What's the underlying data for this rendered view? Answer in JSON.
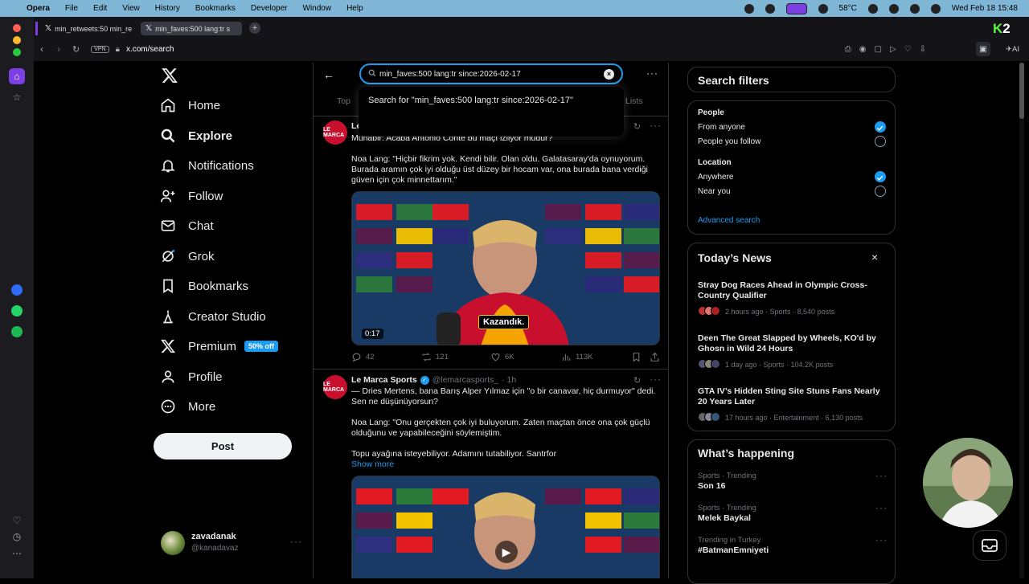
{
  "menubar": {
    "app": "Opera",
    "items": [
      "File",
      "Edit",
      "View",
      "History",
      "Bookmarks",
      "Developer",
      "Window",
      "Help"
    ],
    "temperature": "58°C",
    "datetime": "Wed Feb 18  15:48"
  },
  "browser": {
    "tabs": [
      {
        "title": "min_retweets:50 min_re"
      },
      {
        "title": "min_faves:500 lang:tr s"
      }
    ],
    "vpn_label": "VPN",
    "url": "x.com/search",
    "ai_label": "AI",
    "brand": "K2"
  },
  "nav": {
    "home": "Home",
    "explore": "Explore",
    "notifications": "Notifications",
    "follow": "Follow",
    "chat": "Chat",
    "grok": "Grok",
    "bookmarks": "Bookmarks",
    "creator_studio": "Creator Studio",
    "premium": "Premium",
    "premium_badge": "50% off",
    "profile": "Profile",
    "more": "More",
    "post": "Post"
  },
  "account": {
    "name": "zavadanak",
    "handle": "@kanadavaz"
  },
  "search": {
    "query": "min_faves:500 lang:tr since:2026-02-17",
    "suggestion": "Search for \"min_faves:500 lang:tr since:2026-02-17\"",
    "tab_top": "Top",
    "tab_lists": "Lists"
  },
  "tweets": [
    {
      "avatar_text": "LE MARCA",
      "name_partial": "Le",
      "lines": "Muhabir: Acaba Antonio Conte bu maçı izliyor mudur?\n\nNoa Lang: \"Hiçbir fikrim yok. Kendi bilir. Olan oldu. Galatasaray'da oynuyorum. Burada aramın çok iyi olduğu üst düzey bir hocam var, ona burada bana verdiği güven için çok minnettarım.\"",
      "video_duration": "0:17",
      "subtitle": "Kazandık.",
      "replies": "42",
      "reposts": "121",
      "likes": "6K",
      "views": "113K"
    },
    {
      "avatar_text": "LE MARCA",
      "name": "Le Marca Sports",
      "handle": "@lemarcasports_",
      "time": "· 1h",
      "lines": "— Dries Mertens, bana Barış Alper Yılmaz için \"o bir canavar, hiç durmuyor\" dedi. Sen ne düşünüyorsun?\n\nNoa Lang: \"Onu gerçekten çok iyi buluyorum. Zaten maçtan önce ona çok güçlü olduğunu ve yapabileceğini söylemiştim.\n\nTopu ayağına isteyebiliyor. Adamını tutabiliyor. Santrfor",
      "show_more": "Show more"
    }
  ],
  "filters": {
    "title": "Search filters",
    "people_label": "People",
    "from_anyone": "From anyone",
    "people_you_follow": "People you follow",
    "location_label": "Location",
    "anywhere": "Anywhere",
    "near_you": "Near you",
    "advanced": "Advanced search"
  },
  "news": {
    "title": "Today’s News",
    "items": [
      {
        "title": "Stray Dog Races Ahead in Olympic Cross-Country Qualifier",
        "meta": "2 hours ago · Sports · 8,540 posts"
      },
      {
        "title": "Deen The Great Slapped by Wheels, KO'd by Ghosn in Wild 24 Hours",
        "meta": "1 day ago · Sports · 104.2K posts"
      },
      {
        "title": "GTA IV’s Hidden Sting Site Stuns Fans Nearly 20 Years Later",
        "meta": "17 hours ago · Entertainment · 6,130 posts"
      }
    ]
  },
  "happening": {
    "title": "What’s happening",
    "items": [
      {
        "context": "Sports · Trending",
        "topic": "Son 16"
      },
      {
        "context": "Sports · Trending",
        "topic": "Melek Baykal"
      },
      {
        "context": "Trending in Turkey",
        "topic": "#BatmanEmniyeti"
      }
    ]
  },
  "colors": {
    "accent": "#1d9bf0",
    "menubar": "#7fb6d6",
    "opera_red": "#c8102e"
  }
}
